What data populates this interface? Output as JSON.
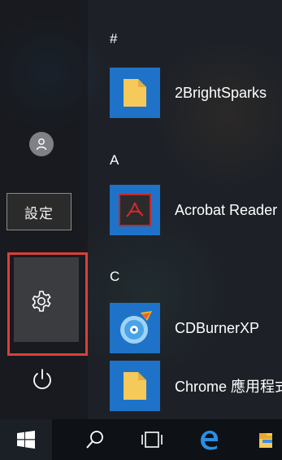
{
  "tooltip": {
    "text": "設定"
  },
  "sections": [
    {
      "letter": "#"
    },
    {
      "letter": "A"
    },
    {
      "letter": "C"
    }
  ],
  "apps": [
    {
      "label": "2BrightSparks",
      "icon": "folder-icon",
      "tile_color": "#1e73c8"
    },
    {
      "label": "Acrobat Reader DC",
      "icon": "acrobat-icon",
      "tile_color": "#1e73c8"
    },
    {
      "label": "CDBurnerXP",
      "icon": "cdburner-icon",
      "tile_color": "#1e73c8"
    },
    {
      "label": "Chrome 應用程式",
      "icon": "folder-icon",
      "tile_color": "#1e73c8"
    }
  ],
  "rail": {
    "avatar_icon": "user-avatar-icon",
    "settings_icon": "gear-icon",
    "power_icon": "power-icon",
    "highlight_color": "#d9403a"
  },
  "taskbar": {
    "items": [
      "start-icon",
      "search-icon",
      "task-view-icon",
      "edge-icon",
      "file-explorer-icon"
    ]
  }
}
